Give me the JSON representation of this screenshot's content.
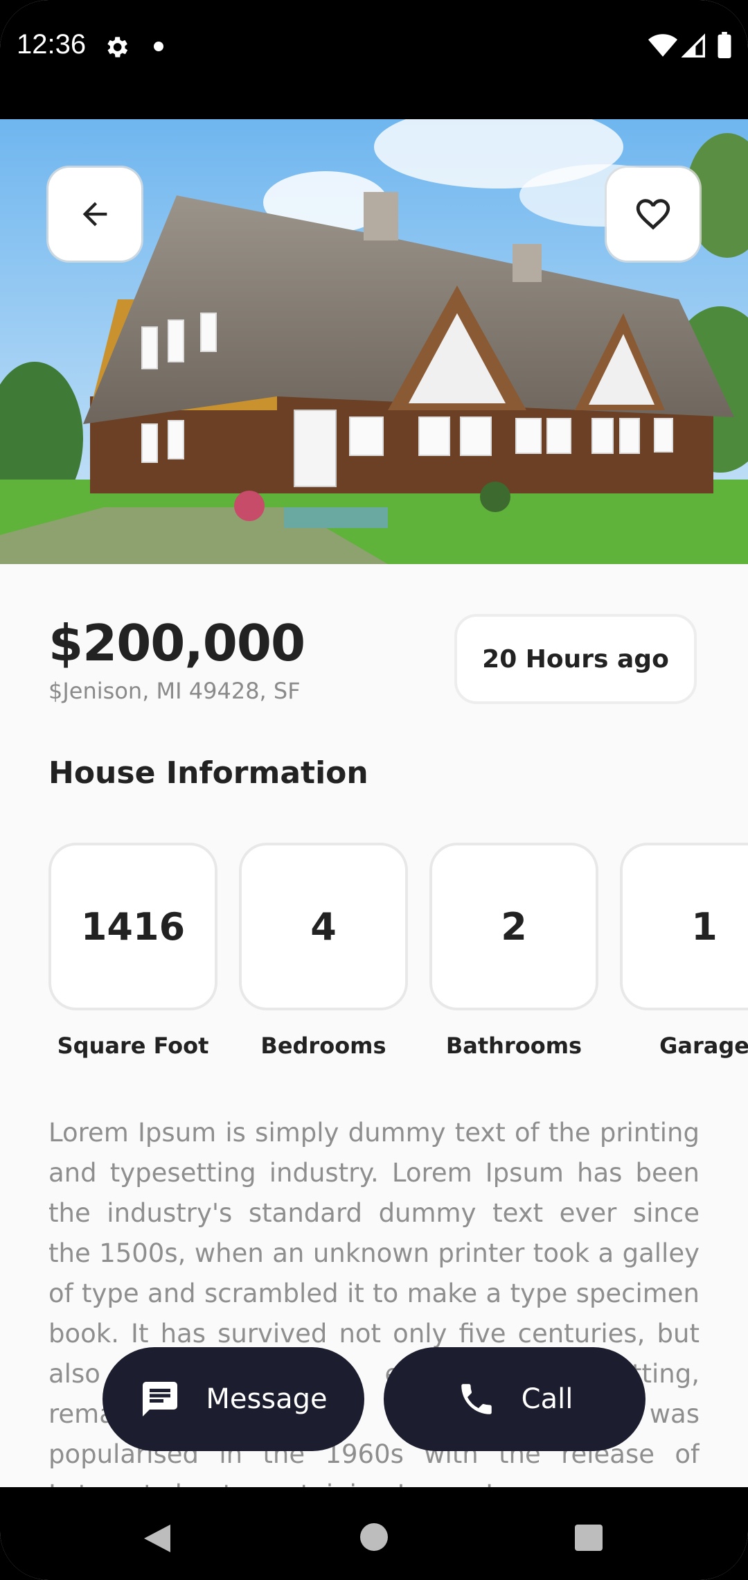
{
  "status_bar": {
    "time": "12:36"
  },
  "listing": {
    "price": "$200,000",
    "address": "$Jenison, MI 49428, SF",
    "posted": "20 Hours ago"
  },
  "section_title": "House Information",
  "info_cards": [
    {
      "value": "1416",
      "label": "Square Foot"
    },
    {
      "value": "4",
      "label": "Bedrooms"
    },
    {
      "value": "2",
      "label": "Bathrooms"
    },
    {
      "value": "1",
      "label": "Garage"
    }
  ],
  "description": "Lorem Ipsum is simply dummy text of the printing and typesetting industry. Lorem Ipsum has been the industry's standard dummy text ever since the 1500s, when an unknown printer took a galley of type and scrambled it to make a type specimen book. It has survived not only five centuries, but also the leap into electronic typesetting, remaining essentially unchanged. It was popularised in the 1960s with the release of Letraset sheets containing Lorem Ipsum passages",
  "actions": {
    "message_label": "Message",
    "call_label": "Call"
  },
  "icons": [
    "gear-icon",
    "wifi-icon",
    "signal-icon",
    "battery-icon",
    "arrow-back-icon",
    "heart-icon",
    "message-icon",
    "phone-icon",
    "nav-back-icon",
    "nav-home-icon",
    "nav-recents-icon"
  ],
  "colors": {
    "accent": "#1c1d2e",
    "text": "#222222",
    "muted": "#8e8e8e"
  }
}
